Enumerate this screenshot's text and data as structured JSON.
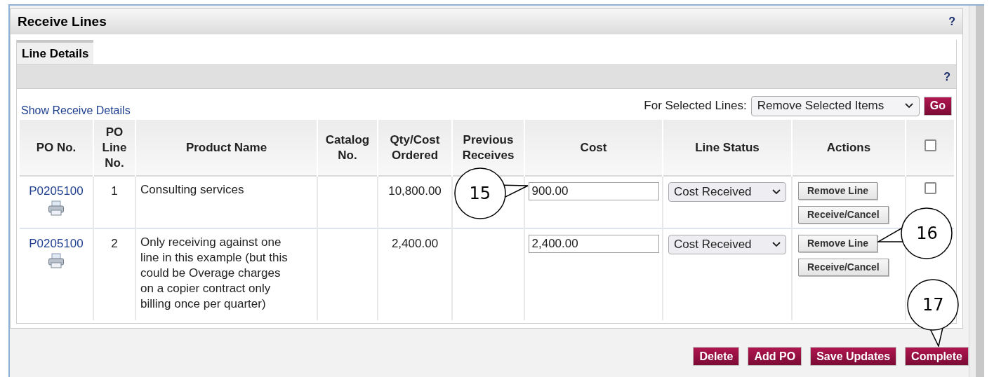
{
  "panel": {
    "title": "Receive Lines",
    "help": "?"
  },
  "tabs": [
    {
      "label": "Line Details",
      "selected": true
    }
  ],
  "tab_bar": {
    "help": "?"
  },
  "show_details_link": "Show Receive Details",
  "bulk_action": {
    "label": "For Selected Lines:",
    "value": "Remove Selected Items",
    "button": "Go"
  },
  "table": {
    "columns": [
      "PO No.",
      "PO Line No.",
      "Product Name",
      "Catalog No.",
      "Qty/Cost Ordered",
      "Previous Receives",
      "Cost",
      "Line Status",
      "Actions"
    ],
    "select_all": {
      "checked": false
    },
    "rows": [
      {
        "po_no": "P0205100",
        "line_no": "1",
        "product": "Consulting services",
        "qty_ordered": "10,800.00",
        "cost": "900.00",
        "cost_callout": "15",
        "line_status": "Cost Received",
        "actions": [
          {
            "label": "Remove Line"
          },
          {
            "label": "Receive/Cancel"
          }
        ],
        "checked": false
      },
      {
        "po_no": "P0205100",
        "line_no": "2",
        "product": "Only receiving against one line in this example (but this could be Overage charges on a copier contract only billing once per quarter)",
        "qty_ordered": "2,400.00",
        "cost": "2,400.00",
        "line_status": "Cost Received",
        "actions": [
          {
            "label": "Remove Line",
            "callout": "16"
          },
          {
            "label": "Receive/Cancel"
          }
        ]
      }
    ]
  },
  "footer_buttons": [
    {
      "label": "Delete"
    },
    {
      "label": "Add PO"
    },
    {
      "label": "Save Updates"
    },
    {
      "label": "Complete",
      "callout": "17"
    }
  ]
}
